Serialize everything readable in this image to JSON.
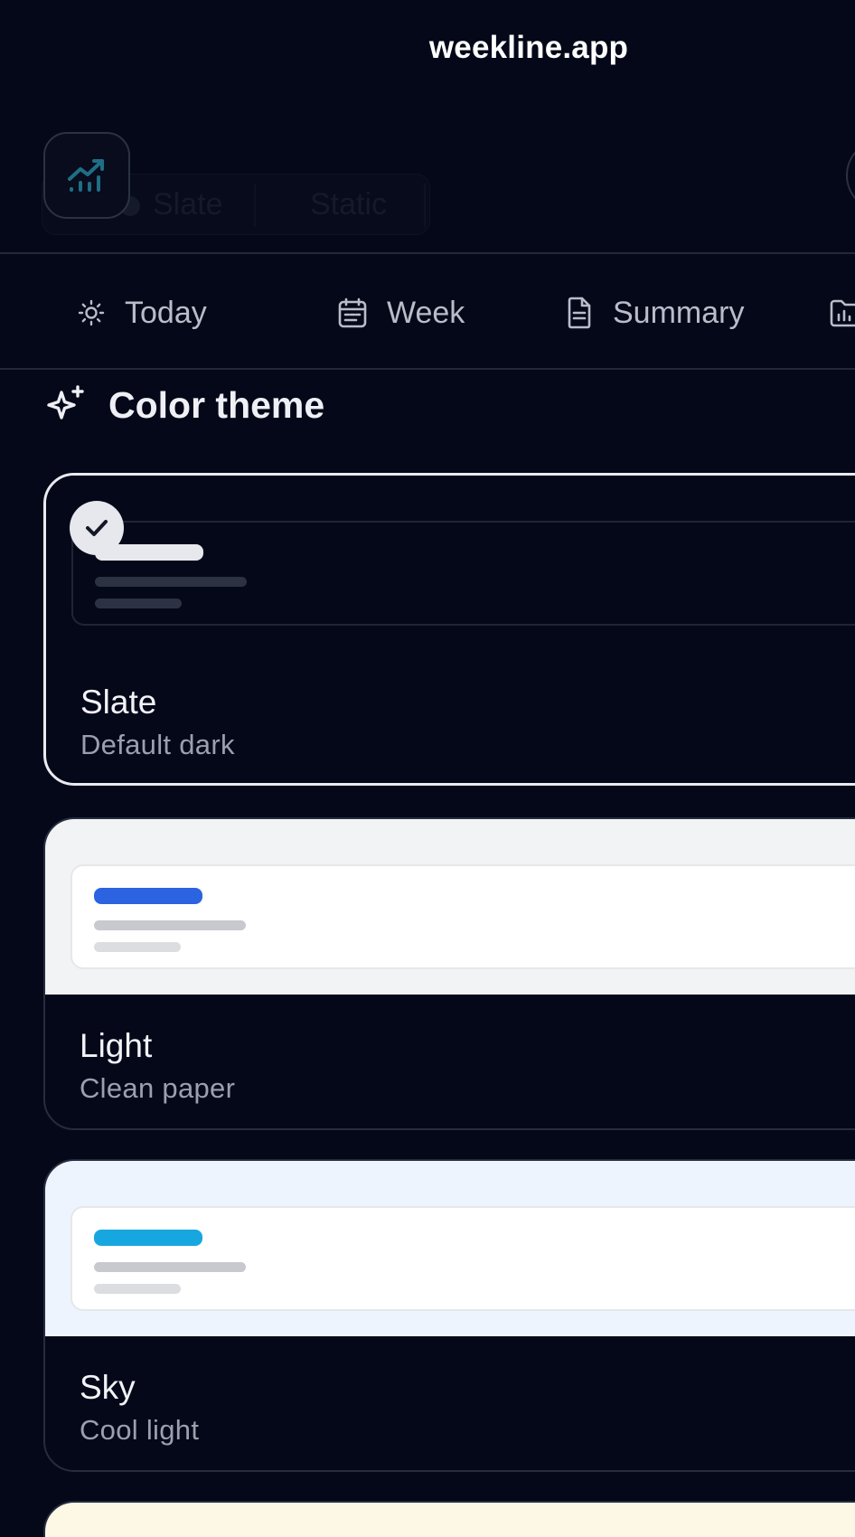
{
  "browser": {
    "url": "weekline.app"
  },
  "header": {
    "logo_icon": "trending-chart-icon",
    "ghost_chip": {
      "theme_label": "Slate",
      "mode_label": "Static"
    }
  },
  "tabs": [
    {
      "label": "Today",
      "icon": "sun-icon"
    },
    {
      "label": "Week",
      "icon": "calendar-icon"
    },
    {
      "label": "Summary",
      "icon": "document-icon"
    },
    {
      "label": "",
      "icon": "folder-chart-icon"
    }
  ],
  "section": {
    "title": "Color theme",
    "icon": "sparkles-icon"
  },
  "themes": [
    {
      "name": "Slate",
      "description": "Default dark",
      "selected": true,
      "colors": {
        "preview_bg": "#050819",
        "inner_bg": "#050819",
        "bar1": "#e6e8ed",
        "bar2": "#2c3244",
        "bar3": "#2c3244"
      }
    },
    {
      "name": "Light",
      "description": "Clean paper",
      "selected": false,
      "colors": {
        "preview_bg": "#f2f3f5",
        "inner_bg": "#ffffff",
        "bar1": "#2b63e0",
        "bar2": "#c8c9ce",
        "bar3": "#dcdde0"
      }
    },
    {
      "name": "Sky",
      "description": "Cool light",
      "selected": false,
      "colors": {
        "preview_bg": "#eef4fd",
        "inner_bg": "#ffffff",
        "bar1": "#17a7e0",
        "bar2": "#c8c9ce",
        "bar3": "#dcdde0"
      }
    },
    {
      "name": "",
      "description": "",
      "selected": false,
      "colors": {
        "preview_bg": "#fdf8e6"
      }
    }
  ]
}
